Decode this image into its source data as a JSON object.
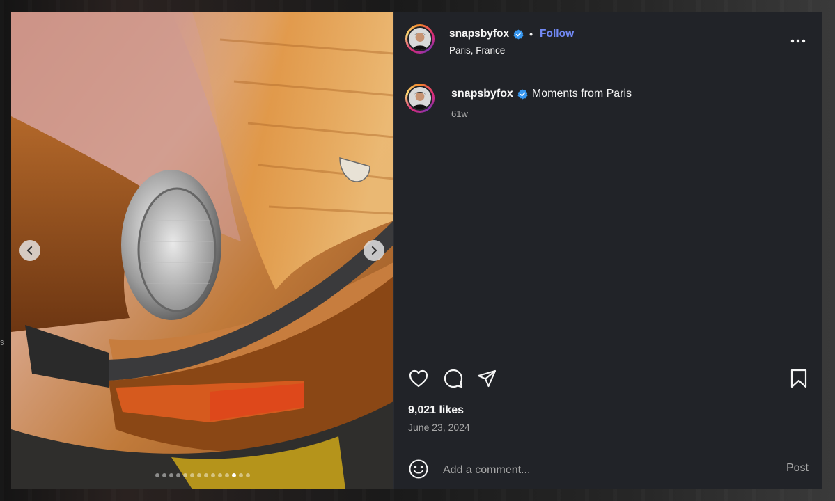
{
  "edge_text": "s",
  "header": {
    "username": "snapsbyfox",
    "separator": "•",
    "follow_label": "Follow",
    "location": "Paris, France"
  },
  "caption": {
    "username": "snapsbyfox",
    "text": "Moments from Paris",
    "age": "61w"
  },
  "media": {
    "slide_count": 14,
    "active_slide_index": 11
  },
  "likes": "9,021 likes",
  "date": "June 23, 2024",
  "comment": {
    "placeholder": "Add a comment...",
    "post_label": "Post"
  },
  "icons": {
    "more": "more-horizontal-icon",
    "verified": "verified-badge-icon",
    "like": "heart-icon",
    "comment": "comment-bubble-icon",
    "share": "paper-plane-icon",
    "save": "bookmark-icon",
    "emoji": "smiley-icon",
    "prev": "chevron-left-icon",
    "next": "chevron-right-icon"
  },
  "colors": {
    "panel_bg": "#212328",
    "link_blue": "#7289f5",
    "verified_blue": "#3797f0",
    "muted_text": "#a8a8a8"
  }
}
